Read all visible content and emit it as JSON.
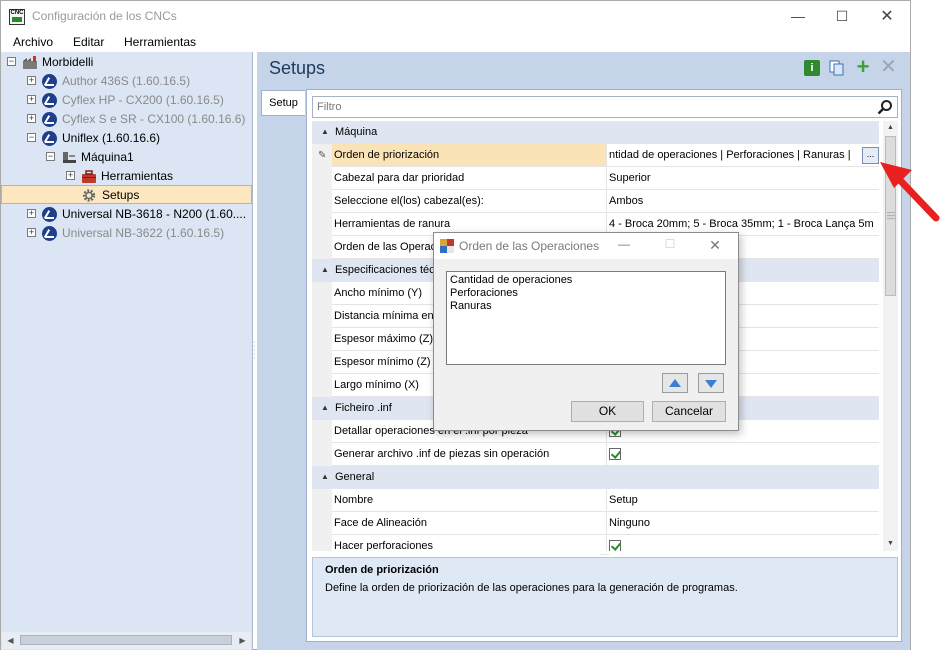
{
  "window": {
    "title": "Configuración de los CNCs",
    "app_icon_text": "CNC",
    "minimize": "—",
    "maximize": "☐",
    "close": "✕"
  },
  "menu": [
    "Archivo",
    "Editar",
    "Herramientas"
  ],
  "tree": {
    "root": {
      "label": "Morbidelli",
      "expander": "⊟"
    },
    "items": [
      {
        "label": "Author 436S (1.60.16.5)",
        "expander": "+",
        "grey": true
      },
      {
        "label": "Cyflex HP - CX200 (1.60.16.5)",
        "expander": "+",
        "grey": true
      },
      {
        "label": "Cyflex S e SR - CX100 (1.60.16.6)",
        "expander": "+",
        "grey": true
      },
      {
        "label": "Uniflex (1.60.16.6)",
        "expander": "−",
        "grey": false
      },
      {
        "label": "Máquina1",
        "expander": "−",
        "grey": false
      },
      {
        "label": "Herramientas",
        "expander": "+",
        "grey": false
      },
      {
        "label": "Setups",
        "expander": "",
        "grey": false
      },
      {
        "label": "Universal NB-3618 - N200 (1.60....",
        "expander": "+",
        "grey": false
      },
      {
        "label": "Universal NB-3622 (1.60.16.5)",
        "expander": "+",
        "grey": true
      }
    ]
  },
  "panel": {
    "title": "Setups",
    "tab": "Setup",
    "filter_placeholder": "Filtro",
    "tools": {
      "info": "i",
      "add": "+",
      "delete": "✕"
    }
  },
  "grid": {
    "rows": [
      {
        "kind": "cat",
        "label": "Máquina"
      },
      {
        "kind": "prop",
        "name": "Orden de priorización",
        "value": "ntidad de operaciones | Perforaciones | Ranuras |",
        "active": true,
        "button": "..."
      },
      {
        "kind": "prop",
        "name": "Cabezal para dar prioridad",
        "value": "Superior"
      },
      {
        "kind": "prop",
        "name": "Seleccione el(los) cabezal(es):",
        "value": "Ambos"
      },
      {
        "kind": "prop",
        "name": "Herramientas de ranura",
        "value": "4 - Broca 20mm; 5 - Broca 35mm; 1 - Broca Lança 5m"
      },
      {
        "kind": "prop",
        "name": "Orden de las Operaciones",
        "value": ""
      },
      {
        "kind": "cat",
        "label": "Especificaciones técnicas"
      },
      {
        "kind": "prop",
        "name": "Ancho mínimo (Y)",
        "value": ""
      },
      {
        "kind": "prop",
        "name": "Distancia mínima entre",
        "value": ""
      },
      {
        "kind": "prop",
        "name": "Espesor máximo (Z)",
        "value": ""
      },
      {
        "kind": "prop",
        "name": "Espesor mínimo (Z)",
        "value": ""
      },
      {
        "kind": "prop",
        "name": "Largo mínimo (X)",
        "value": ""
      },
      {
        "kind": "cat",
        "label": "Ficheiro .inf"
      },
      {
        "kind": "prop",
        "name": "Detallar operaciones en el .inf por pieza",
        "value": "",
        "check": true
      },
      {
        "kind": "prop",
        "name": "Generar archivo .inf de piezas sin operación",
        "value": "",
        "check": true
      },
      {
        "kind": "cat",
        "label": "General"
      },
      {
        "kind": "prop",
        "name": "Nombre",
        "value": "Setup"
      },
      {
        "kind": "prop",
        "name": "Face de Alineación",
        "value": "Ninguno"
      },
      {
        "kind": "prop",
        "name": "Hacer perforaciones",
        "value": "",
        "check": true
      }
    ]
  },
  "description": {
    "title": "Orden de priorización",
    "text": "Define la orden de priorización de las operaciones para la generación de programas."
  },
  "dialog": {
    "title": "Orden de las Operaciones",
    "minimize": "—",
    "maximize": "☐",
    "close": "✕",
    "items": [
      "Cantidad de operaciones",
      "Perforaciones",
      "Ranuras"
    ],
    "ok": "OK",
    "cancel": "Cancelar"
  },
  "colors": {
    "accent_red": "#e8201f",
    "selection": "#fde7c0",
    "panel_bg": "#c5d4e9",
    "tree_bg": "#dbe5f3"
  }
}
